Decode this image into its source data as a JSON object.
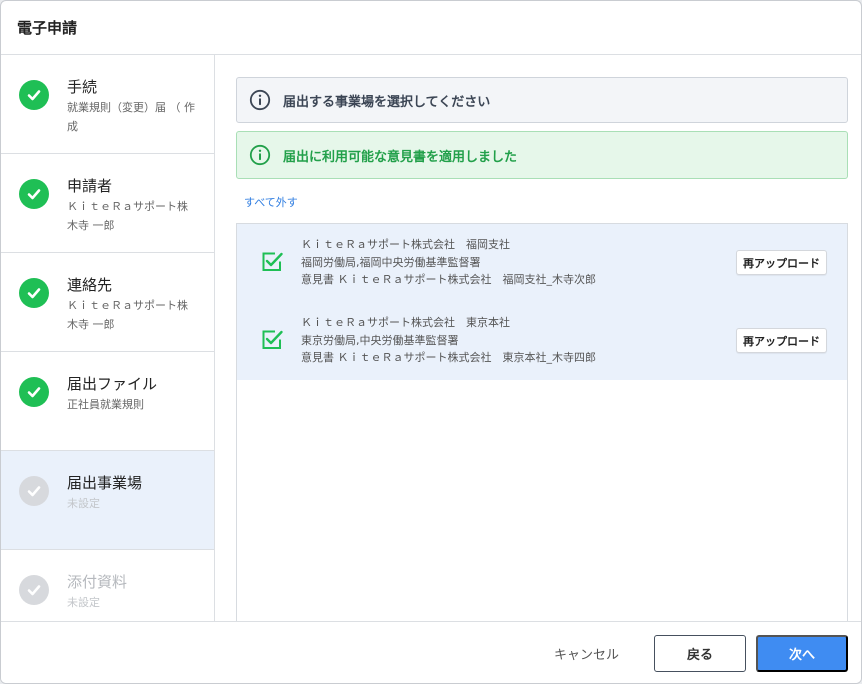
{
  "dialog": {
    "title": "電子申請"
  },
  "steps": [
    {
      "title": "手続",
      "sub": "就業規則（変更）届 （ 作成",
      "state": "done"
    },
    {
      "title": "申請者",
      "sub": "ＫｉｔｅＲａサポート株",
      "sub2": "木寺 一郎",
      "state": "done"
    },
    {
      "title": "連絡先",
      "sub": "ＫｉｔｅＲａサポート株",
      "sub2": "木寺 一郎",
      "state": "done"
    },
    {
      "title": "届出ファイル",
      "sub": "正社員就業規則",
      "state": "done"
    },
    {
      "title": "届出事業場",
      "sub": "未設定",
      "state": "current"
    },
    {
      "title": "添付資料",
      "sub": "未設定",
      "state": "todo"
    }
  ],
  "alerts": {
    "info": "届出する事業場を選択してください",
    "success": "届出に利用可能な意見書を適用しました"
  },
  "deselect_all": "すべて外す",
  "offices": [
    {
      "line1": "ＫｉｔｅＲａサポート株式会社　福岡支社",
      "line2": "福岡労働局,福岡中央労働基準監督署",
      "line3": "意見書 ＫｉｔｅＲａサポート株式会社　福岡支社_木寺次郎",
      "button": "再アップロード",
      "checked": true
    },
    {
      "line1": "ＫｉｔｅＲａサポート株式会社　東京本社",
      "line2": "東京労働局,中央労働基準監督署",
      "line3": "意見書 ＫｉｔｅＲａサポート株式会社　東京本社_木寺四郎",
      "button": "再アップロード",
      "checked": true
    }
  ],
  "footer": {
    "cancel": "キャンセル",
    "back": "戻る",
    "next": "次へ"
  },
  "colors": {
    "success": "#1fbf55",
    "primary": "#3f8cf2",
    "selected_row": "#eaf1fb",
    "link": "#2f7de1"
  }
}
